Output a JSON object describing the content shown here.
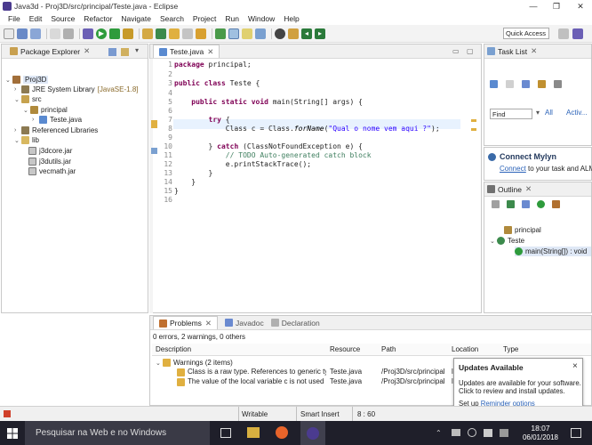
{
  "window": {
    "title": "Java3d - Proj3D/src/principal/Teste.java - Eclipse",
    "minimize": "—",
    "maximize": "❐",
    "close": "✕"
  },
  "menu": [
    "File",
    "Edit",
    "Source",
    "Refactor",
    "Navigate",
    "Search",
    "Project",
    "Run",
    "Window",
    "Help"
  ],
  "toolbar": {
    "quick_access": "Quick Access"
  },
  "package_explorer": {
    "title": "Package Explorer",
    "items": [
      {
        "label": "Proj3D",
        "depth": 0
      },
      {
        "label": "JRE System Library",
        "suffix": "[JavaSE-1.8]",
        "depth": 1
      },
      {
        "label": "src",
        "depth": 1
      },
      {
        "label": "principal",
        "depth": 2
      },
      {
        "label": "Teste.java",
        "depth": 3
      },
      {
        "label": "Referenced Libraries",
        "depth": 1
      },
      {
        "label": "lib",
        "depth": 1
      },
      {
        "label": "j3dcore.jar",
        "depth": 2
      },
      {
        "label": "j3dutils.jar",
        "depth": 2
      },
      {
        "label": "vecmath.jar",
        "depth": 2
      }
    ]
  },
  "editor": {
    "tab": "Teste.java",
    "line_numbers": [
      "1",
      "2",
      "3",
      "4",
      "5",
      "6",
      "7",
      "8",
      "9",
      "10",
      "11",
      "12",
      "13",
      "14",
      "15",
      "16"
    ]
  },
  "task_list": {
    "title": "Task List",
    "find_placeholder": "Find",
    "all": "All",
    "activate": "Activ..."
  },
  "mylyn": {
    "title": "Connect Mylyn",
    "link": "Connect",
    "text": " to your task and ALM"
  },
  "outline": {
    "title": "Outline",
    "items": [
      {
        "label": "principal"
      },
      {
        "label": "Teste"
      },
      {
        "label": "main(String[]) : void"
      }
    ]
  },
  "problems": {
    "tabs": [
      "Problems",
      "Javadoc",
      "Declaration"
    ],
    "summary": "0 errors, 2 warnings, 0 others",
    "columns": [
      "Description",
      "Resource",
      "Path",
      "Location",
      "Type"
    ],
    "group": "Warnings (2 items)",
    "rows": [
      {
        "description": "Class is a raw type. References to generic type",
        "resource": "Teste.java",
        "path": "/Proj3D/src/principal",
        "location": "lin"
      },
      {
        "description": "The value of the local variable c is not used",
        "resource": "Teste.java",
        "path": "/Proj3D/src/principal",
        "location": "lin"
      }
    ]
  },
  "updates": {
    "title": "Updates Available",
    "close": "×",
    "body": "Updates are available for your software. Click to review and install updates.",
    "setup": "Set up ",
    "link": "Reminder options"
  },
  "status": {
    "writable": "Writable",
    "insert": "Smart Insert",
    "position": "8 : 60"
  },
  "taskbar": {
    "search": "Pesquisar na Web e no Windows",
    "time": "18:07",
    "date": "06/01/2018"
  },
  "colors": {
    "keyword": "#7f0055",
    "string": "#2a00ff",
    "comment": "#3f7f5f",
    "taskbar": "#1f1f2a"
  }
}
